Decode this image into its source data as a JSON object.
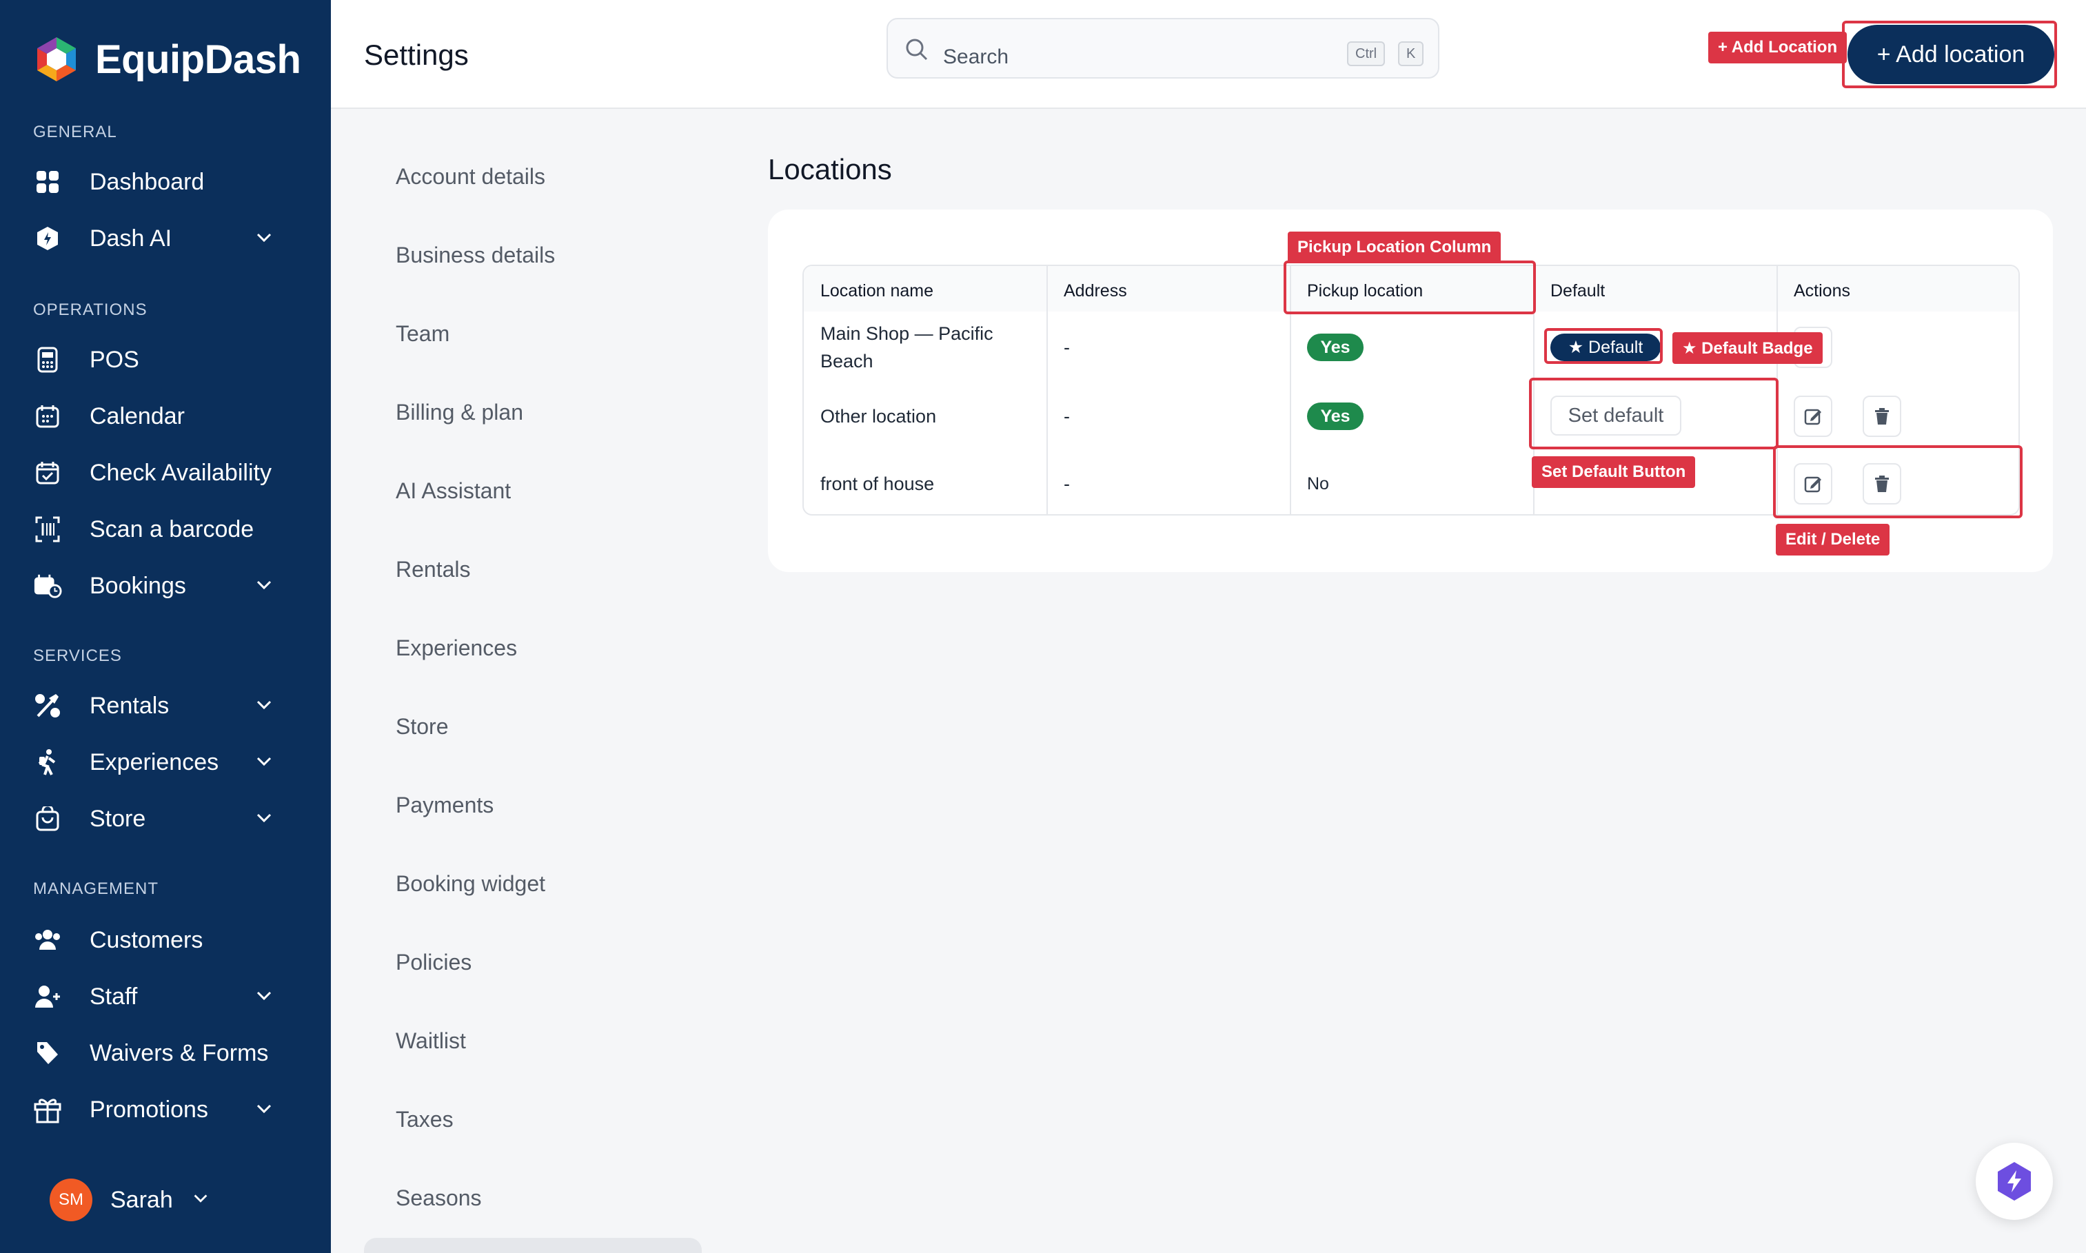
{
  "app": {
    "name": "EquipDash"
  },
  "header": {
    "title": "Settings",
    "search_placeholder": "Search",
    "kbd_ctrl": "Ctrl",
    "kbd_k": "K",
    "add_button": "+ Add location"
  },
  "sidebar": {
    "sections": {
      "general": "GENERAL",
      "operations": "OPERATIONS",
      "services": "SERVICES",
      "management": "MANAGEMENT"
    },
    "items": {
      "dashboard": "Dashboard",
      "dash_ai": "Dash AI",
      "pos": "POS",
      "calendar": "Calendar",
      "check_availability": "Check Availability",
      "scan_barcode": "Scan a barcode",
      "bookings": "Bookings",
      "rentals": "Rentals",
      "experiences": "Experiences",
      "store": "Store",
      "customers": "Customers",
      "staff": "Staff",
      "waivers": "Waivers & Forms",
      "promotions": "Promotions"
    },
    "user": {
      "initials": "SM",
      "name": "Sarah"
    },
    "icons": {
      "dashboard": "grid-icon",
      "dash_ai": "ai-icon",
      "pos": "pos-icon",
      "calendar": "calendar-icon",
      "check": "calendar-check-icon",
      "scan": "barcode-icon",
      "bookings": "bookings-icon",
      "rentals": "rentals-icon",
      "experiences": "hiker-icon",
      "store": "store-icon",
      "customers": "customers-icon",
      "staff": "staff-icon",
      "waivers": "tag-icon",
      "promotions": "gift-icon"
    }
  },
  "settings_menu": [
    "Account details",
    "Business details",
    "Team",
    "Billing & plan",
    "AI Assistant",
    "Rentals",
    "Experiences",
    "Store",
    "Payments",
    "Booking widget",
    "Policies",
    "Waitlist",
    "Taxes",
    "Seasons"
  ],
  "locations": {
    "title": "Locations",
    "columns": [
      "Location name",
      "Address",
      "Pickup location",
      "Default",
      "Actions"
    ],
    "rows": [
      {
        "name": "Main Shop — Pacific Beach",
        "address": "-",
        "pickup": "Yes",
        "default_badge": "★ Default"
      },
      {
        "name": "Other location",
        "address": "-",
        "pickup": "Yes",
        "set_default": "Set default"
      },
      {
        "name": "front of house",
        "address": "-",
        "pickup": "No"
      }
    ]
  },
  "annotations": {
    "add_location": "+ Add Location",
    "pickup_column": "Pickup Location Column",
    "default_badge": "★ Default Badge",
    "set_default": "Set Default Button",
    "edit_delete": "Edit / Delete"
  },
  "colors": {
    "sidebar_bg": "#0b2f5b",
    "accent": "#0b2f5b",
    "success": "#1e8a4c",
    "annotation": "#dc3545",
    "avatar": "#f15a24"
  }
}
